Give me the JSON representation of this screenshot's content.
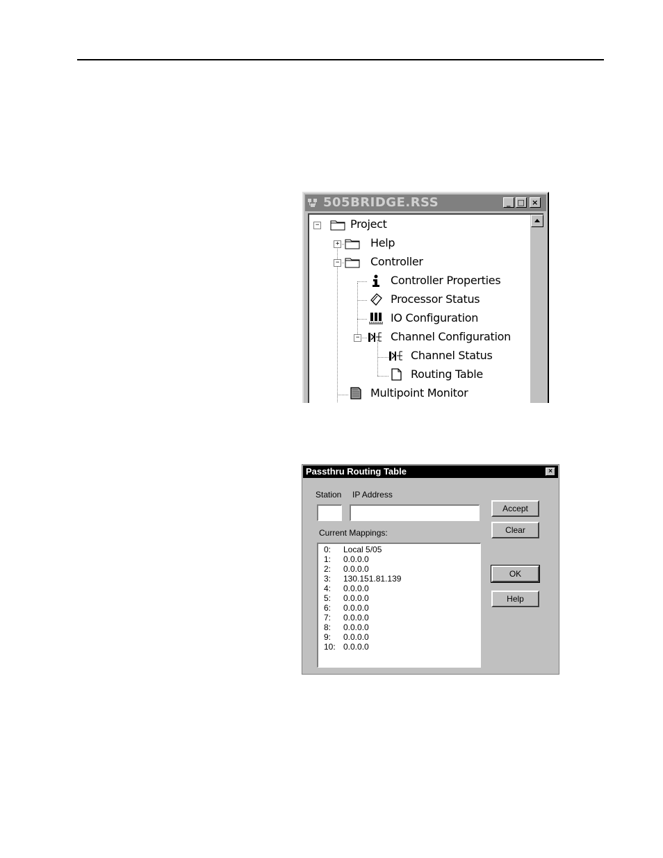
{
  "tree_window": {
    "title": "505BRIDGE.RSS",
    "minimize": "_",
    "maximize": "□",
    "close": "×",
    "nodes": [
      {
        "label": "Project",
        "icon": "folder-icon",
        "expander": "−"
      },
      {
        "label": "Help",
        "icon": "folder-icon",
        "expander": "+"
      },
      {
        "label": "Controller",
        "icon": "folder-icon",
        "expander": "−"
      },
      {
        "label": "Controller Properties",
        "icon": "info-icon"
      },
      {
        "label": "Processor Status",
        "icon": "processor-icon"
      },
      {
        "label": "IO Configuration",
        "icon": "io-rack-icon"
      },
      {
        "label": "Channel Configuration",
        "icon": "channel-icon",
        "expander": "−"
      },
      {
        "label": "Channel Status",
        "icon": "channel-icon"
      },
      {
        "label": "Routing Table",
        "icon": "document-icon"
      },
      {
        "label": "Multipoint Monitor",
        "icon": "monitor-doc-icon"
      }
    ]
  },
  "dialog": {
    "title": "Passthru Routing Table",
    "close": "×",
    "station_label": "Station",
    "ip_label": "IP Address",
    "station_value": "",
    "ip_value": "",
    "mappings_label": "Current Mappings:",
    "mappings": [
      {
        "station": "0:",
        "ip": "Local 5/05"
      },
      {
        "station": "1:",
        "ip": "0.0.0.0"
      },
      {
        "station": "2:",
        "ip": "0.0.0.0"
      },
      {
        "station": "3:",
        "ip": "130.151.81.139"
      },
      {
        "station": "4:",
        "ip": "0.0.0.0"
      },
      {
        "station": "5:",
        "ip": "0.0.0.0"
      },
      {
        "station": "6:",
        "ip": "0.0.0.0"
      },
      {
        "station": "7:",
        "ip": "0.0.0.0"
      },
      {
        "station": "8:",
        "ip": "0.0.0.0"
      },
      {
        "station": "9:",
        "ip": "0.0.0.0"
      },
      {
        "station": "10:",
        "ip": " 0.0.0.0"
      }
    ],
    "buttons": {
      "accept": "Accept",
      "clear": "Clear",
      "ok": "OK",
      "help": "Help"
    }
  }
}
